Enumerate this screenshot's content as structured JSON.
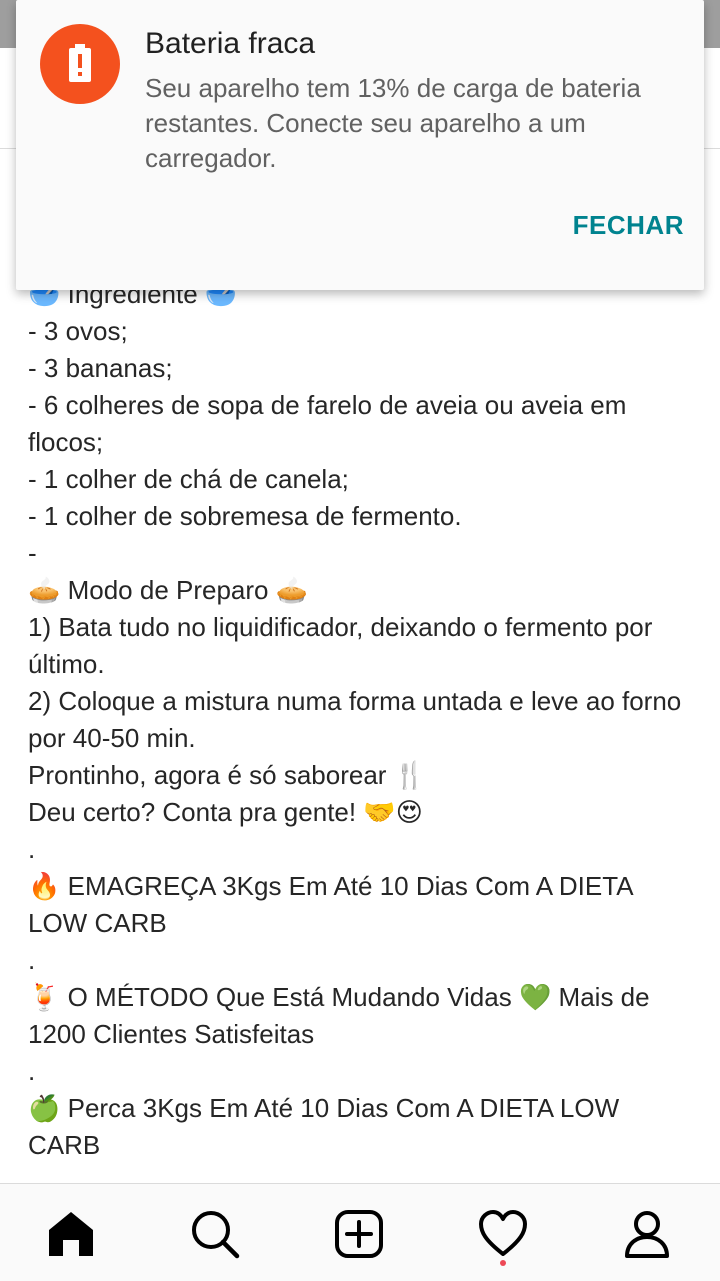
{
  "notification": {
    "title": "Bateria fraca",
    "body": "Seu aparelho tem 13% de carga de bateria restantes. Conecte seu aparelho a um carregador.",
    "action_label": "FECHAR",
    "icon": "battery-alert-icon",
    "accent_color": "#f4511e",
    "action_color": "#00838f"
  },
  "post": {
    "lines": [
      "🥣 Ingrediente 🥣",
      "- 3 ovos;",
      "- 3 bananas;",
      "- 6 colheres de sopa de farelo de aveia ou aveia em flocos;",
      "- 1 colher de chá de canela;",
      "- 1 colher de sobremesa de fermento.",
      "-",
      "🥧 Modo de Preparo 🥧",
      "1) Bata tudo no liquidificador, deixando o fermento por último.",
      "2) Coloque a mistura numa forma untada e leve ao forno por 40-50 min.",
      "Prontinho, agora é só saborear 🍴",
      "Deu certo? Conta pra gente! 🤝😍",
      ".",
      "🔥 EMAGREÇA 3Kgs Em Até 10 Dias Com A DIETA LOW CARB",
      ".",
      "🍹 O MÉTODO Que Está Mudando Vidas 💚 Mais de 1200 Clientes Satisfeitas",
      ".",
      "🍏 Perca 3Kgs Em Até 10 Dias Com A DIETA LOW CARB"
    ]
  },
  "bottom_nav": {
    "items": [
      {
        "name": "home-icon",
        "active": true
      },
      {
        "name": "search-icon",
        "active": false
      },
      {
        "name": "add-post-icon",
        "active": false
      },
      {
        "name": "heart-icon",
        "active": false,
        "has_badge": true
      },
      {
        "name": "profile-icon",
        "active": false
      }
    ],
    "badge_color": "#ed4956"
  }
}
